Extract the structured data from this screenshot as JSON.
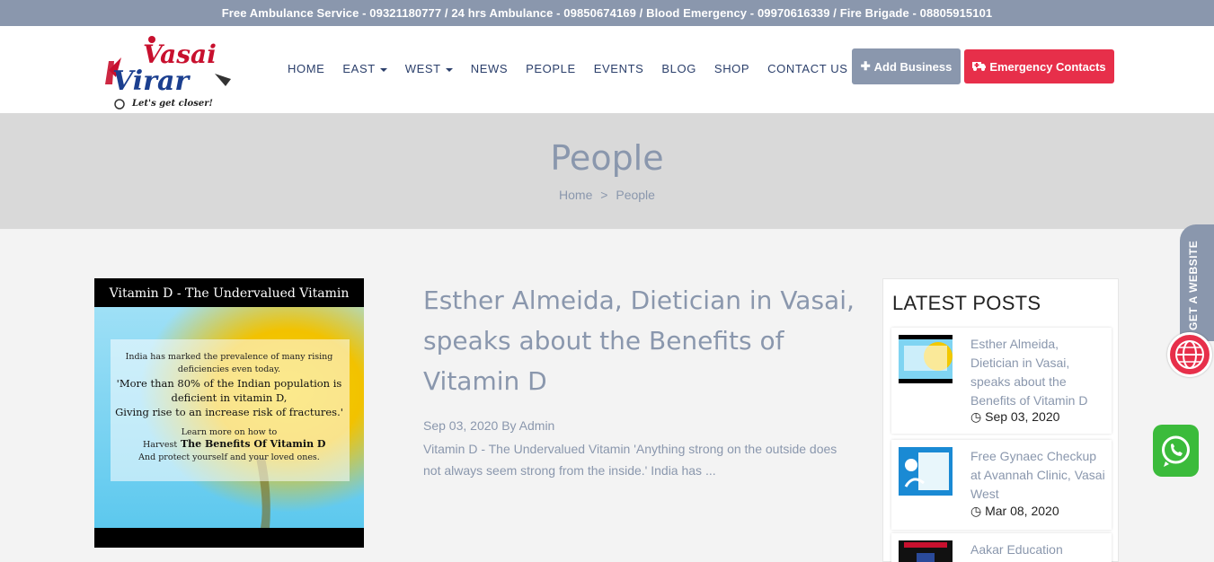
{
  "topbar": {
    "text": "Free Ambulance Service - 09321180777 / 24 hrs Ambulance - 09850674169 / Blood Emergency - 09970616339 / Fire Brigade - 08805915101"
  },
  "logo": {
    "line1": "Vasai",
    "line2": "Virar",
    "tagline": "Let's get closer!"
  },
  "nav": {
    "items": [
      {
        "label": "HOME",
        "dropdown": false
      },
      {
        "label": "EAST",
        "dropdown": true
      },
      {
        "label": "WEST",
        "dropdown": true
      },
      {
        "label": "NEWS",
        "dropdown": false
      },
      {
        "label": "PEOPLE",
        "dropdown": false
      },
      {
        "label": "EVENTS",
        "dropdown": false
      },
      {
        "label": "BLOG",
        "dropdown": false
      },
      {
        "label": "SHOP",
        "dropdown": false
      },
      {
        "label": "CONTACT US",
        "dropdown": false
      }
    ]
  },
  "header_buttons": {
    "add_business": "Add Business",
    "add_business_icon": "plus-icon",
    "emergency": "Emergency Contacts",
    "emergency_icon": "ambulance-icon"
  },
  "banner": {
    "title": "People",
    "breadcrumb_home": "Home",
    "breadcrumb_sep": ">",
    "breadcrumb_current": "People"
  },
  "post": {
    "image": {
      "heading": "Vitamin D - The Undervalued Vitamin",
      "line1": "India has marked the prevalence of many rising",
      "line2": "deficiencies even today.",
      "line3": "'More than 80% of the Indian population is",
      "line4": "deficient in vitamin D,",
      "line5": "Giving rise to an increase risk of fractures.'",
      "line6": "Learn more on how to",
      "line7a": "Harvest",
      "line7b": "The Benefits Of Vitamin D",
      "line8": "And protect yourself and your loved ones."
    },
    "title": "Esther Almeida, Dietician in Vasai, speaks about the Benefits of Vitamin D",
    "date": "Sep 03, 2020",
    "by": "By",
    "author": "Admin",
    "excerpt": "Vitamin D - The Undervalued Vitamin 'Anything strong on the outside does not always seem strong from the inside.' India has ..."
  },
  "sidebar": {
    "heading": "LATEST POSTS",
    "posts": [
      {
        "title": "Esther Almeida, Dietician in Vasai, speaks about the Benefits of Vitamin D",
        "date": "Sep 03, 2020"
      },
      {
        "title": "Free Gynaec Checkup at Avannah Clinic, Vasai West",
        "date": "Mar 08, 2020"
      },
      {
        "title": "Aakar Education",
        "date": ""
      }
    ]
  },
  "floating": {
    "get_website": "GET A WEBSITE",
    "globe_icon": "globe-icon",
    "whatsapp_icon": "whatsapp-icon"
  },
  "colors": {
    "accent": "#8a97ad",
    "emergency": "#e72f4a",
    "whatsapp": "#3bbb3b"
  }
}
